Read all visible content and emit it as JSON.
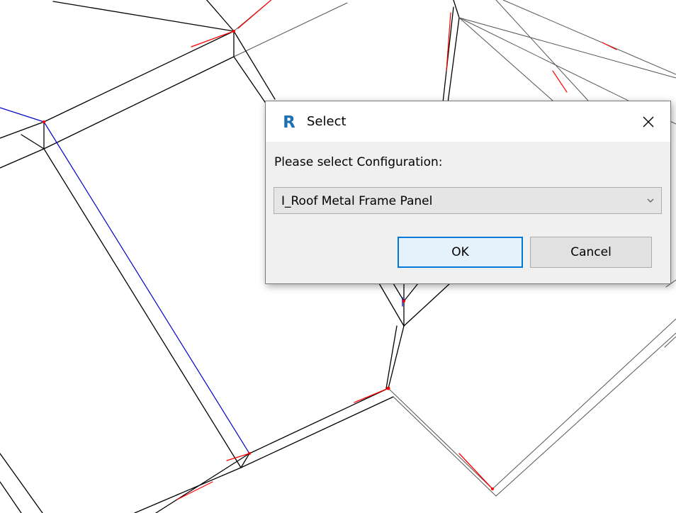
{
  "dialog": {
    "title": "Select",
    "app_icon": "R",
    "close_symbol": "✕",
    "prompt": "Please select Configuration:",
    "configuration": {
      "selected": "I_Roof Metal Frame Panel"
    },
    "ok_label": "OK",
    "cancel_label": "Cancel"
  },
  "icons": {
    "app": "revit-app-icon",
    "close": "close-icon",
    "dropdown": "chevron-down-icon"
  },
  "colors": {
    "line": "#000000",
    "thin_line": "#555555",
    "accent_red": "#ff0000",
    "accent_blue": "#0000cc",
    "focus_border": "#0078d7"
  }
}
